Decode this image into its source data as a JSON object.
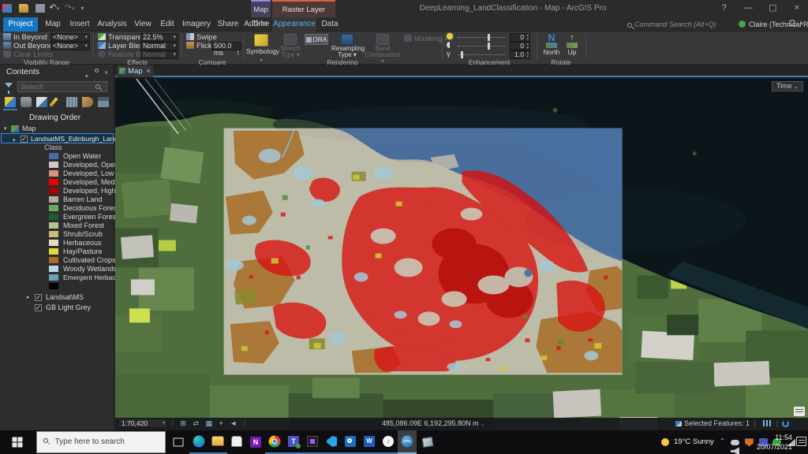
{
  "titlebar": {
    "title": "DeepLearning_LandClassification - Map - ArcGIS Pro",
    "contextual_map": "Map",
    "contextual_raster": "Raster Layer"
  },
  "tabs": {
    "project": "Project",
    "main": [
      "Map",
      "Insert",
      "Analysis",
      "View",
      "Edit",
      "Imagery",
      "Share",
      "Add-In"
    ],
    "time": "Time",
    "appearance": "Appearance",
    "data": "Data"
  },
  "topbar": {
    "command_search_placeholder": "Command Search (Alt+Q)",
    "user_name": "Claire (Technical Research)"
  },
  "ribbon": {
    "visibility_range": {
      "group_label": "Visibility Range",
      "in_beyond": "In Beyond",
      "out_beyond": "Out Beyond",
      "clear_limits": "Clear Limits",
      "in_beyond_value": "<None>",
      "out_beyond_value": "<None>"
    },
    "effects": {
      "group_label": "Effects",
      "transparency": "Transparency",
      "transparency_value": "22.5%",
      "layer_blend": "Layer Blend",
      "layer_blend_value": "Normal",
      "feature_blend": "Feature Blend",
      "feature_blend_value": "Normal"
    },
    "compare": {
      "group_label": "Compare",
      "swipe": "Swipe",
      "flicker": "Flicker",
      "flicker_value": "500.0 ms"
    },
    "rendering": {
      "group_label": "Rendering",
      "symbology": "Symbology",
      "stretch_line1": "Stretch",
      "stretch_line2": "Type",
      "dra": "DRA",
      "resampling_line1": "Resampling",
      "resampling_line2": "Type",
      "band_line1": "Band",
      "band_line2": "Combination",
      "masking": "Masking"
    },
    "enhancement": {
      "group_label": "Enhancement",
      "brightness_value": "0",
      "contrast_value": "0",
      "gamma_value": "1.0",
      "gamma_symbol": "γ"
    },
    "rotate": {
      "group_label": "Rotate",
      "north": "North",
      "up": "Up"
    }
  },
  "contents": {
    "title": "Contents",
    "search_placeholder": "Search",
    "drawing_order_label": "Drawing Order",
    "map_layer": "Map",
    "landuse_layer": "LandsatMS_Edinburgh_LandUse",
    "class_heading": "Class",
    "classes": [
      {
        "label": "Open Water",
        "color": "#466b9f"
      },
      {
        "label": "Developed, Open Space",
        "color": "#dec5c5"
      },
      {
        "label": "Developed, Low Intensity",
        "color": "#d99282"
      },
      {
        "label": "Developed, Medium Intensity",
        "color": "#eb0000"
      },
      {
        "label": "Developed, High Intensity",
        "color": "#ab0000"
      },
      {
        "label": "Barren Land",
        "color": "#b3ac9f"
      },
      {
        "label": "Deciduous Forest",
        "color": "#68ab5f"
      },
      {
        "label": "Evergreen Forest",
        "color": "#1c5f2c"
      },
      {
        "label": "Mixed Forest",
        "color": "#b5c58f"
      },
      {
        "label": "Shrub/Scrub",
        "color": "#ccb879"
      },
      {
        "label": "Herbaceous",
        "color": "#dfdfc2"
      },
      {
        "label": "Hay/Pasture",
        "color": "#dfd93d"
      },
      {
        "label": "Cultivated Crops",
        "color": "#ab6c28"
      },
      {
        "label": "Woody Wetlands",
        "color": "#b8d9eb"
      },
      {
        "label": "Emergent Herbaceous Wetlands",
        "color": "#6c9fb8"
      }
    ],
    "unlabeled_swatch_color": "#000000",
    "landsat_layer": "Landsat\\MS",
    "basemap_layer": "GB Light Grey"
  },
  "map": {
    "tab_label": "Map",
    "time_button": "Time",
    "scale": "1:70,420",
    "coordinates": "485,086.09E 6,192,295.80N m",
    "selected_features": "Selected Features: 1"
  },
  "taskbar": {
    "search_placeholder": "Type here to search",
    "weather": "19°C Sunny",
    "clock_time": "11:54",
    "clock_date": "20/07/2021"
  }
}
